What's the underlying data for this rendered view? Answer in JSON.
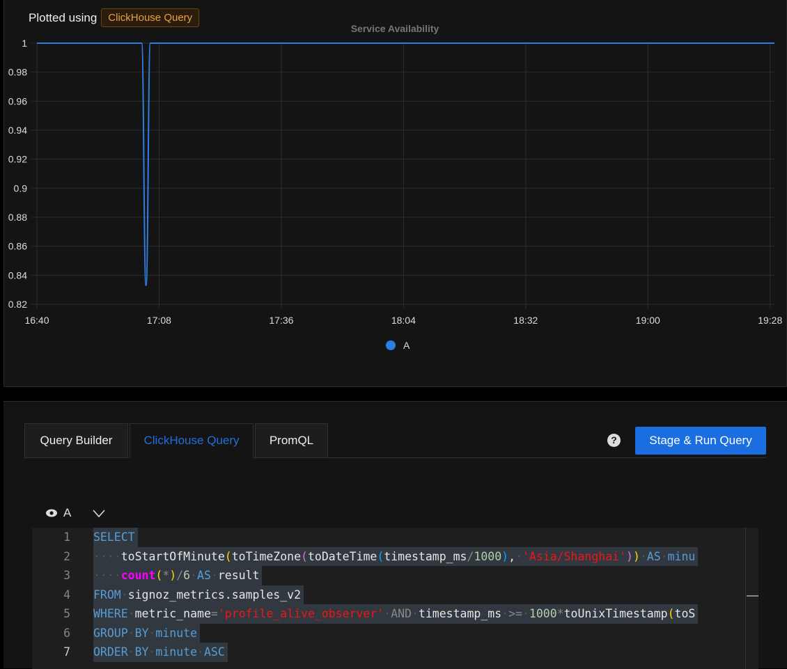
{
  "header": {
    "plotted_label": "Plotted using",
    "plotted_badge": "ClickHouse Query"
  },
  "chart_data": {
    "type": "line",
    "title": "Service Availability",
    "x_ticks": [
      "16:40",
      "17:08",
      "17:36",
      "18:04",
      "18:32",
      "19:00",
      "19:28"
    ],
    "y_ticks": [
      "1",
      "0.98",
      "0.96",
      "0.94",
      "0.92",
      "0.9",
      "0.88",
      "0.86",
      "0.84",
      "0.82"
    ],
    "ylim": [
      0.82,
      1
    ],
    "xlim": [
      "16:40",
      "19:29"
    ],
    "grid": true,
    "legend_placement": "bottom",
    "series": [
      {
        "name": "A",
        "color": "#2f7de1",
        "points": [
          [
            "16:40",
            1
          ],
          [
            "17:04",
            1
          ],
          [
            "17:05",
            0.833
          ],
          [
            "17:06",
            1
          ],
          [
            "19:29",
            1
          ]
        ]
      }
    ]
  },
  "tabs": [
    {
      "label": "Query Builder"
    },
    {
      "label": "ClickHouse Query",
      "active": true
    },
    {
      "label": "PromQL"
    }
  ],
  "help_icon": "?",
  "run_button": "Stage & Run Query",
  "query": {
    "name": "A",
    "visible_icon": "eye-icon",
    "collapse_icon": "chevron-down-icon",
    "lines": [
      {
        "n": "1",
        "tokens": [
          [
            "kw",
            "SELECT"
          ]
        ]
      },
      {
        "n": "2",
        "tokens": [
          [
            "ws",
            "····"
          ],
          [
            "id",
            "toStartOfMinute"
          ],
          [
            "p1",
            "("
          ],
          [
            "id",
            "toTimeZone"
          ],
          [
            "p2",
            "("
          ],
          [
            "id",
            "toDateTime"
          ],
          [
            "p3",
            "("
          ],
          [
            "id",
            "timestamp_ms"
          ],
          [
            "op",
            "/"
          ],
          [
            "num",
            "1000"
          ],
          [
            "p3",
            ")"
          ],
          [
            "id",
            ","
          ],
          [
            "ws",
            "·"
          ],
          [
            "str",
            "'Asia/Shanghai'"
          ],
          [
            "p2",
            ")"
          ],
          [
            "p1",
            ")"
          ],
          [
            "ws",
            "·"
          ],
          [
            "kw",
            "AS"
          ],
          [
            "ws",
            "·"
          ],
          [
            "kw",
            "minu"
          ]
        ]
      },
      {
        "n": "3",
        "tokens": [
          [
            "ws",
            "····"
          ],
          [
            "cnt",
            "count"
          ],
          [
            "p1",
            "("
          ],
          [
            "op",
            "*"
          ],
          [
            "p1",
            ")"
          ],
          [
            "op",
            "/"
          ],
          [
            "num",
            "6"
          ],
          [
            "ws",
            "·"
          ],
          [
            "kw",
            "AS"
          ],
          [
            "ws",
            "·"
          ],
          [
            "id",
            "result"
          ]
        ]
      },
      {
        "n": "4",
        "tokens": [
          [
            "kw",
            "FROM"
          ],
          [
            "ws",
            "·"
          ],
          [
            "id",
            "signoz_metrics.samples_v2"
          ]
        ]
      },
      {
        "n": "5",
        "tokens": [
          [
            "kw",
            "WHERE"
          ],
          [
            "ws",
            "·"
          ],
          [
            "id",
            "metric_name"
          ],
          [
            "op",
            "="
          ],
          [
            "str",
            "'profile_alive_observer'"
          ],
          [
            "ws",
            "·"
          ],
          [
            "op",
            "AND"
          ],
          [
            "ws",
            "·"
          ],
          [
            "id",
            "timestamp_ms"
          ],
          [
            "ws",
            "·"
          ],
          [
            "op",
            ">="
          ],
          [
            "ws",
            "·"
          ],
          [
            "num",
            "1000"
          ],
          [
            "op",
            "*"
          ],
          [
            "id",
            "toUnixTimestamp"
          ],
          [
            "p1",
            "("
          ],
          [
            "id",
            "toS"
          ]
        ]
      },
      {
        "n": "6",
        "tokens": [
          [
            "kw",
            "GROUP"
          ],
          [
            "ws",
            "·"
          ],
          [
            "kw",
            "BY"
          ],
          [
            "ws",
            "·"
          ],
          [
            "kw",
            "minute"
          ]
        ]
      },
      {
        "n": "7",
        "tokens": [
          [
            "kw",
            "ORDER"
          ],
          [
            "ws",
            "·"
          ],
          [
            "kw",
            "BY"
          ],
          [
            "ws",
            "·"
          ],
          [
            "kw",
            "minute"
          ],
          [
            "ws",
            "·"
          ],
          [
            "kw",
            "ASC"
          ]
        ]
      }
    ]
  }
}
